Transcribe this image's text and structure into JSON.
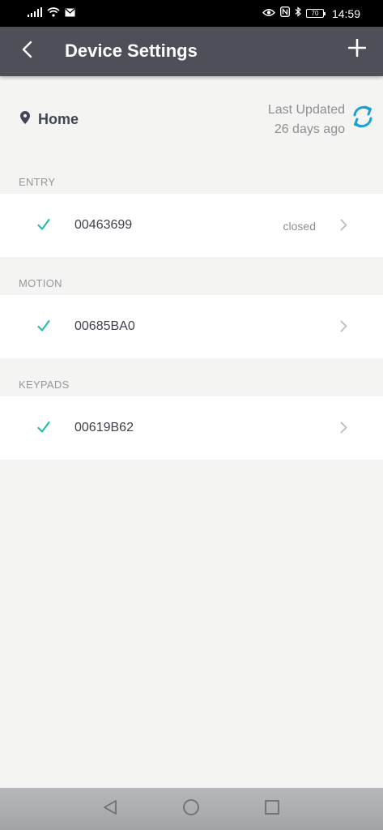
{
  "status_bar": {
    "time": "14:59",
    "battery": "70"
  },
  "header": {
    "title": "Device Settings"
  },
  "location": {
    "name": "Home",
    "last_updated_label": "Last Updated",
    "last_updated_value": "26 days ago"
  },
  "sections": [
    {
      "label": "ENTRY",
      "device": {
        "id": "00463699",
        "status": "closed"
      }
    },
    {
      "label": "MOTION",
      "device": {
        "id": "00685BA0",
        "status": ""
      }
    },
    {
      "label": "KEYPADS",
      "device": {
        "id": "00619B62",
        "status": ""
      }
    }
  ],
  "colors": {
    "app_bar": "#4d5059",
    "accent_teal": "#2bbcac",
    "refresh_blue": "#1a9fd6",
    "background": "#f4f4f2"
  }
}
